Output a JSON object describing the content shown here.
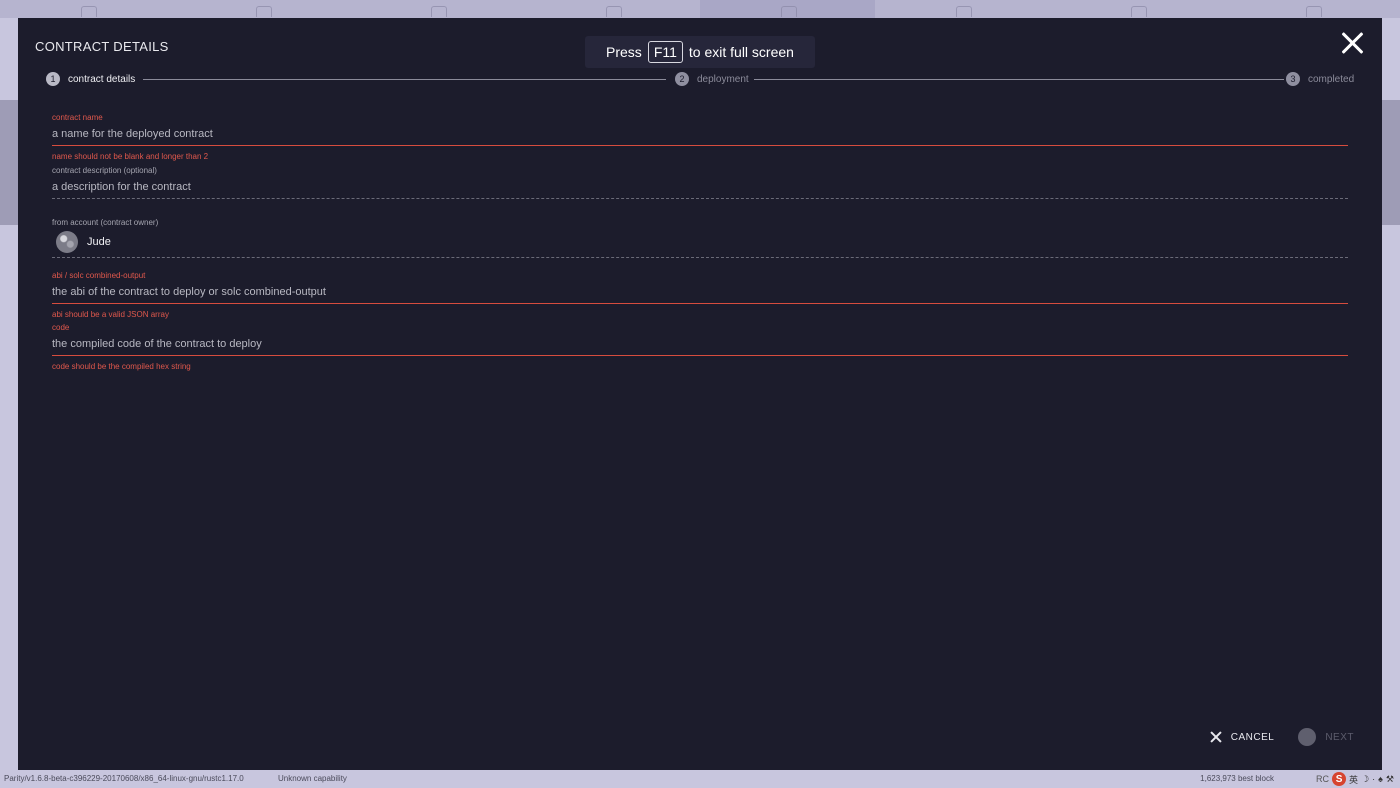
{
  "background": {
    "nav_tabs": 8,
    "active_tab_index": 4
  },
  "modal": {
    "title": "CONTRACT DETAILS",
    "fullscreen_banner": {
      "prefix": "Press",
      "key": "F11",
      "suffix": "to exit full screen"
    },
    "steps": [
      {
        "number": "1",
        "label": "contract details",
        "active": true
      },
      {
        "number": "2",
        "label": "deployment",
        "active": false
      },
      {
        "number": "3",
        "label": "completed",
        "active": false
      }
    ],
    "form": {
      "contract_name": {
        "label": "contract name",
        "placeholder": "a name for the deployed contract",
        "error": "name should not be blank and longer than 2"
      },
      "contract_description": {
        "label": "contract description (optional)",
        "placeholder": "a description for the contract"
      },
      "from_account": {
        "label": "from account (contract owner)",
        "value": "Jude"
      },
      "abi": {
        "label": "abi / solc combined-output",
        "placeholder": "the abi of the contract to deploy or solc combined-output",
        "error": "abi should be a valid JSON array"
      },
      "code": {
        "label": "code",
        "placeholder": "the compiled code of the contract to deploy",
        "error": "code should be the compiled hex string"
      }
    },
    "actions": {
      "cancel_label": "CANCEL",
      "next_label": "NEXT"
    }
  },
  "statusbar": {
    "version": "Parity/v1.6.8-beta-c396229-20170608/x86_64-linux-gnu/rustc1.17.0",
    "capability": "Unknown capability",
    "block": "1,623,973 best block",
    "tray_text": "RC",
    "tray_s": "S",
    "tray_ime": "英"
  },
  "colors": {
    "modal_bg": "#1c1c2c",
    "error": "#e0584c",
    "page_bg": "#c8c6de"
  }
}
